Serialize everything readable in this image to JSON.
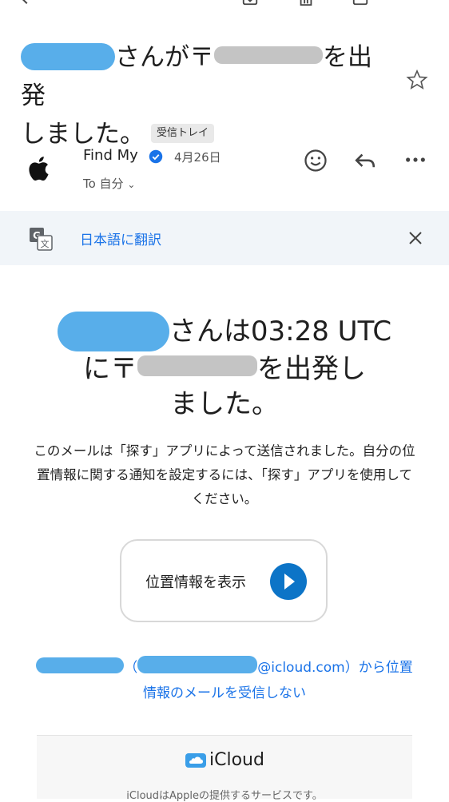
{
  "email": {
    "subject_part1": "さんが〒",
    "subject_part2": "を出発",
    "subject_line2": "しました。",
    "folder_badge": "受信トレイ"
  },
  "sender": {
    "name": "Find My",
    "date": "4月26日",
    "to_label": "To 自分"
  },
  "translate": {
    "label": "日本語に翻訳"
  },
  "body": {
    "headline_part1": "さんは03:28 UTC",
    "headline_part2": "に〒",
    "headline_part3": "を出発し",
    "headline_part4": "ました。",
    "description": "このメールは「探す」アプリによって送信されました。自分の位置情報に関する通知を設定するには、「探す」アプリを使用してください。",
    "button_label": "位置情報を表示",
    "optout_part1": "（",
    "optout_part2": "@icloud.com）から位置",
    "optout_part3": "情報のメールを受信しない"
  },
  "footer": {
    "brand": "iCloud",
    "note": "iCloudはAppleの提供するサービスです。"
  },
  "colors": {
    "link": "#1a73e8",
    "redaction_blue": "#58aeea",
    "redaction_gray": "#c4c4c4",
    "play_button": "#0c74c7"
  }
}
